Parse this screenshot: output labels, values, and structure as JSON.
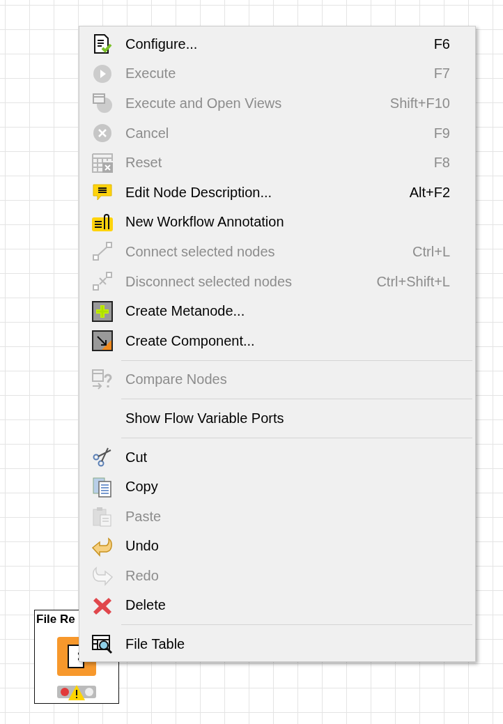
{
  "node": {
    "label": "File Re"
  },
  "menu": [
    {
      "kind": "configure",
      "label": "Configure...",
      "shortcut": "F6",
      "disabled": false
    },
    {
      "kind": "execute",
      "label": "Execute",
      "shortcut": "F7",
      "disabled": true
    },
    {
      "kind": "execute-open",
      "label": "Execute and Open Views",
      "shortcut": "Shift+F10",
      "disabled": true
    },
    {
      "kind": "cancel",
      "label": "Cancel",
      "shortcut": "F9",
      "disabled": true
    },
    {
      "kind": "reset",
      "label": "Reset",
      "shortcut": "F8",
      "disabled": true
    },
    {
      "kind": "description",
      "label": "Edit Node Description...",
      "shortcut": "Alt+F2",
      "disabled": false
    },
    {
      "kind": "annotation",
      "label": "New Workflow Annotation",
      "disabled": false
    },
    {
      "kind": "connect",
      "label": "Connect selected nodes",
      "shortcut": "Ctrl+L",
      "disabled": true
    },
    {
      "kind": "disconnect",
      "label": "Disconnect selected nodes",
      "shortcut": "Ctrl+Shift+L",
      "disabled": true
    },
    {
      "kind": "metanode",
      "label": "Create Metanode...",
      "disabled": false
    },
    {
      "kind": "component",
      "label": "Create Component...",
      "disabled": false
    },
    {
      "kind": "separator"
    },
    {
      "kind": "compare",
      "label": "Compare Nodes",
      "disabled": true
    },
    {
      "kind": "separator"
    },
    {
      "kind": "plain",
      "label": "Show Flow Variable Ports",
      "disabled": false
    },
    {
      "kind": "separator"
    },
    {
      "kind": "cut",
      "label": "Cut",
      "disabled": false
    },
    {
      "kind": "copy",
      "label": "Copy",
      "disabled": false
    },
    {
      "kind": "paste",
      "label": "Paste",
      "disabled": true
    },
    {
      "kind": "undo",
      "label": "Undo",
      "disabled": false
    },
    {
      "kind": "redo",
      "label": "Redo",
      "disabled": true
    },
    {
      "kind": "delete",
      "label": "Delete",
      "disabled": false
    },
    {
      "kind": "separator"
    },
    {
      "kind": "table",
      "label": "File Table",
      "disabled": false
    }
  ]
}
